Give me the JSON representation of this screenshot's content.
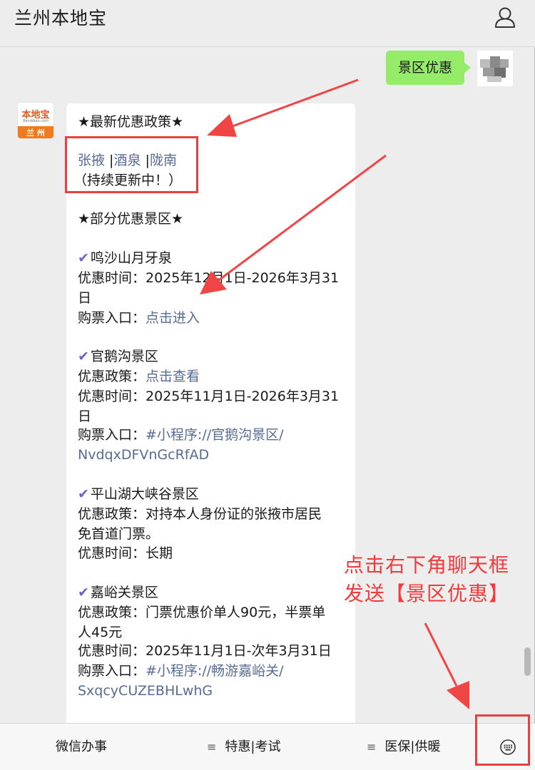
{
  "header": {
    "title": "兰州本地宝",
    "profile_icon": "person-icon"
  },
  "outgoing_message": {
    "text": "景区优惠"
  },
  "bot": {
    "logo_text": "本地宝",
    "logo_subtext": "Bendibao.com",
    "logo_city": "兰 州"
  },
  "message": {
    "policy_header": "★最新优惠政策★",
    "cities": [
      "张掖",
      "酒泉",
      "陇南"
    ],
    "city_sep": " |",
    "updating": "（持续更新中！）",
    "section_header": "★部分优惠景区★",
    "check_icon": "checkmark-icon",
    "spots": [
      {
        "name": "鸣沙山月牙泉",
        "time_label": "优惠时间：",
        "time_line1": "2025年12月1日-2026年3月31",
        "time_line2": "日",
        "ticket_label": "购票入口：",
        "ticket_link": "点击进入"
      },
      {
        "name": "官鹅沟景区",
        "policy_label": "优惠政策：",
        "policy_link": "点击查看",
        "time_label": "优惠时间：",
        "time_line1": "2025年11月1日-2026年3月31",
        "time_line2": "日",
        "ticket_label": "购票入口：",
        "ticket_link_line1": "#小程序://官鹅沟景区/",
        "ticket_link_line2": "NvdqxDFVnGcRfAD"
      },
      {
        "name": "平山湖大峡谷景区",
        "policy_label": "优惠政策：",
        "policy_line1": "对持本人身份证的张掖市居民",
        "policy_line2": "免首道门票。",
        "time_label": "优惠时间：",
        "time_value": "长期"
      },
      {
        "name": "嘉峪关景区",
        "policy_label": "优惠政策：",
        "policy_line1": "门票优惠价单人90元，半票单",
        "policy_line2": "人45元",
        "time_label": "优惠时间：",
        "time_value": "2025年11月1日-次年3月31日",
        "ticket_label": "购票入口：",
        "ticket_link_line1": "#小程序://畅游嘉峪关/",
        "ticket_link_line2": "SxqcyCUZEBHLwhG"
      }
    ]
  },
  "annotation": {
    "line1": "点击右下角聊天框",
    "line2": "发送【景区优惠】",
    "color": "#ef3b3b"
  },
  "bottom_menu": {
    "items": [
      "微信办事",
      "特惠|考试",
      "医保|供暖"
    ],
    "menu_icon": "≡",
    "keyboard_icon": "keyboard-icon"
  }
}
